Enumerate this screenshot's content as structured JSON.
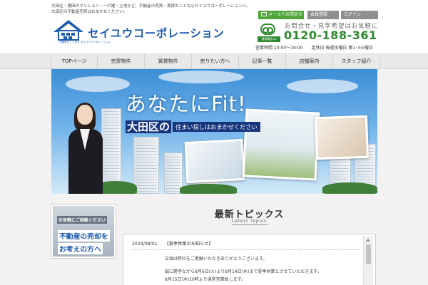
{
  "header": {
    "intro_lines": [
      "大田区・蒲田のマンション・一戸建・土地など、不動産の売買・賃貸のことならセイユウコーポレーションへ。",
      "大田区の不動産売買はおまかせください。"
    ],
    "logo_text": "セイユウコーポレーション",
    "logo_house_label": "不動産のことなら セイユウコーポレーション",
    "buttons": {
      "mail": "メールでお問合せ",
      "register": "会員登録",
      "login": "ログイン"
    },
    "freedial_label": "携帯電話OK",
    "call_lead": "お問合せ・見学希望はお気軽に",
    "phone": "0120-188-361",
    "hours": "営業時間 10:00～19:00　　定休日 毎週水曜日 第1･3火曜日"
  },
  "nav": [
    "TOPページ",
    "売買物件",
    "賃貸物件",
    "売りたい方へ",
    "記事一覧",
    "店舗案内",
    "スタッフ紹介"
  ],
  "hero": {
    "title": "あなたにFit!",
    "sub1": "大田区の",
    "sub2": "住まい探しはおまかせください"
  },
  "side_banner": {
    "line1": "お気軽にご相談ください",
    "big1": "不動産の売却を",
    "big2": "お考えの方へ"
  },
  "topics": {
    "title": "最新トピックス",
    "subtitle": "Latest Topics",
    "item": {
      "date": "2024/08/01",
      "title": "【夏季休業のお知らせ】",
      "lines": [
        "日頃は弊社をご愛顧いただきありがとうございます。",
        "誠に勝手ながら8月6日(火)より8月14日(水)まで夏季休業とさせていただきます。",
        "8月15日(木)10時より通常営業致します。"
      ]
    }
  },
  "colors": {
    "brand_blue": "#1d5bb0",
    "phone_green": "#2f8a2f",
    "mail_green": "#4fa53a"
  }
}
